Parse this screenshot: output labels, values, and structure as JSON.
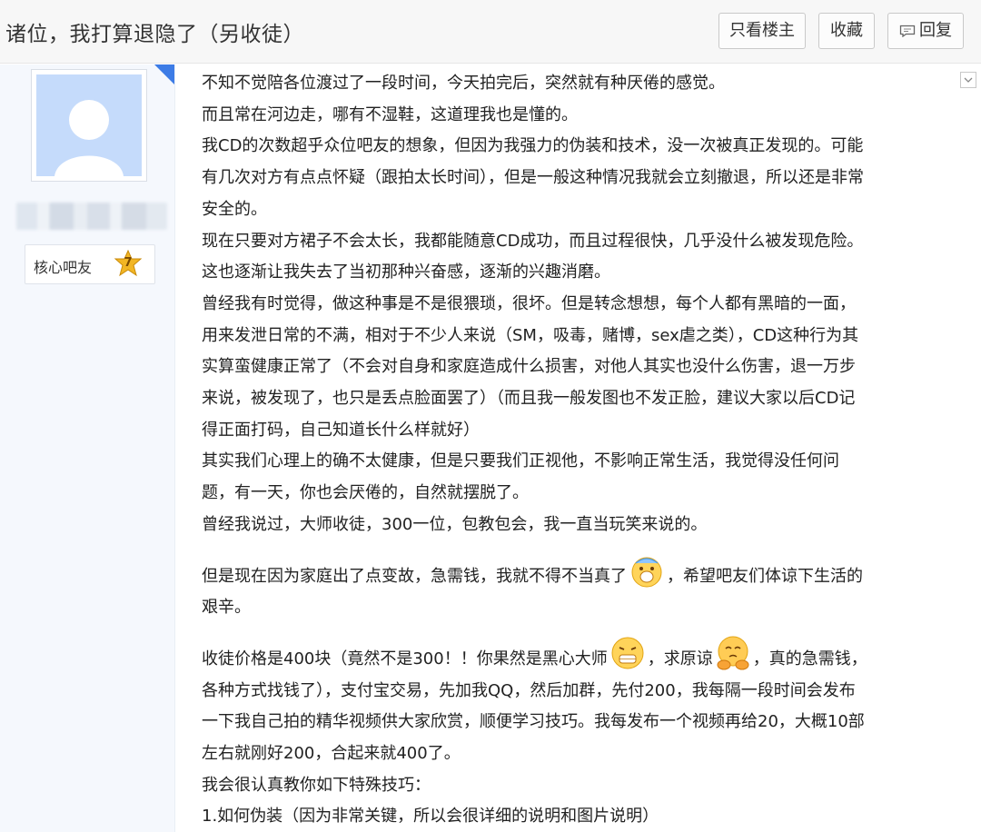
{
  "thread": {
    "title": "诸位，我打算退隐了（另收徒）"
  },
  "toolbar": {
    "only_op_label": "只看楼主",
    "favorite_label": "收藏",
    "reply_label": "回复"
  },
  "author": {
    "rank_label": "核心吧友",
    "level": "7"
  },
  "post": {
    "paragraphs": [
      "不知不觉陪各位渡过了一段时间，今天拍完后，突然就有种厌倦的感觉。",
      "而且常在河边走，哪有不湿鞋，这道理我也是懂的。",
      "我CD的次数超乎众位吧友的想象，但因为我强力的伪装和技术，没一次被真正发现的。可能",
      "有几次对方有点点怀疑（跟拍太长时间），但是一般这种情况我就会立刻撤退，所以还是非常",
      "安全的。",
      "现在只要对方裙子不会太长，我都能随意CD成功，而且过程很快，几乎没什么被发现危险。",
      "这也逐渐让我失去了当初那种兴奋感，逐渐的兴趣消磨。",
      "曾经我有时觉得，做这种事是不是很猥琐，很坏。但是转念想想，每个人都有黑暗的一面，",
      "用来发泄日常的不满，相对于不少人来说（SM，吸毒，赌博，sex虐之类），CD这种行为其",
      "实算蛮健康正常了（不会对自身和家庭造成什么损害，对他人其实也没什么伤害，退一万步",
      "来说，被发现了，也只是丢点脸面罢了）（而且我一般发图也不发正脸，建议大家以后CD记",
      "得正面打码，自己知道长什么样就好）",
      "其实我们心理上的确不太健康，但是只要我们正视他，不影响正常生活，我觉得没任何问",
      "题，有一天，你也会厌倦的，自然就摆脱了。",
      "曾经我说过，大师收徒，300一位，包教包会，我一直当玩笑来说的。"
    ],
    "para_need_money_a": "但是现在因为家庭出了点变故，急需钱，我就不得不当真了",
    "para_need_money_b": "，希望吧友们体谅下生活的",
    "para_need_money_c": "艰辛。",
    "para_price_a": "收徒价格是400块（竟然不是300！！你果然是黑心大师",
    "para_price_b": "，求原谅",
    "para_price_c": "，真的急需钱，",
    "paragraphs_2": [
      "各种方式找钱了），支付宝交易，先加我QQ，然后加群，先付200，我每隔一段时间会发布",
      "一下我自己拍的精华视频供大家欣赏，顺便学习技巧。我每发布一个视频再给20，大概10部",
      "左右就刚好200，合起来就400了。",
      "我会很认真教你如下特殊技巧：",
      "1.如何伪装（因为非常关键，所以会很详细的说明和图片说明）"
    ]
  },
  "icons": {
    "reply": "reply-icon",
    "avatar": "default-avatar-icon",
    "level": "level-star-icon",
    "emoji_1": "sweat-emoji-icon",
    "emoji_2": "grimace-emoji-icon",
    "emoji_3": "sorry-emoji-icon",
    "menu": "dropdown-arrow-icon"
  },
  "colors": {
    "accent": "#3d7ce6",
    "sidebar_bg": "#f5f8fd",
    "level_star": "#f0b21a"
  }
}
